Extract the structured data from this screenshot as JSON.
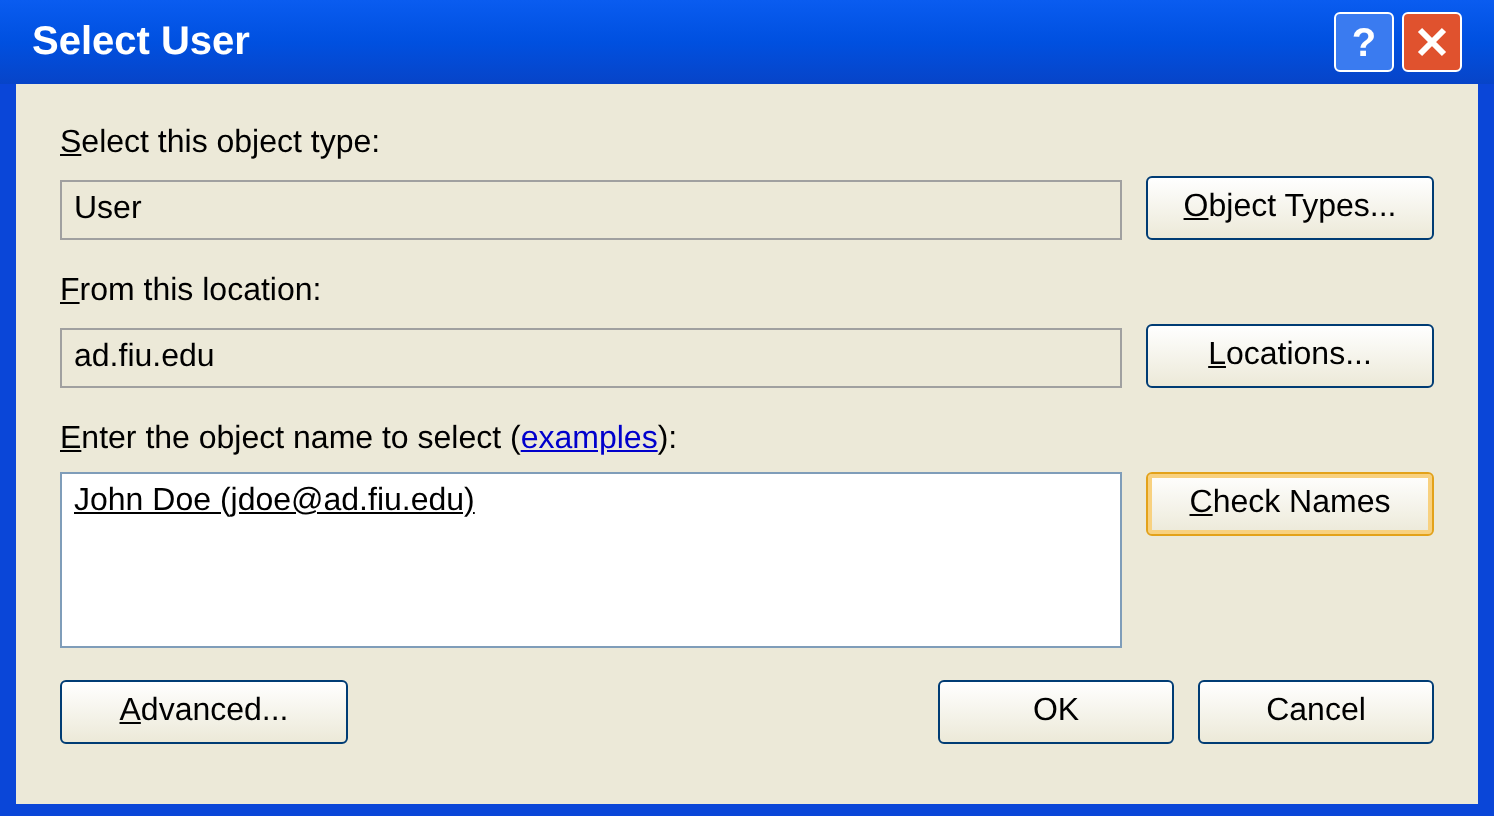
{
  "window": {
    "title": "Select User",
    "help_button": "?"
  },
  "object_type": {
    "label": [
      {
        "text": "S",
        "underlined": true
      },
      {
        "text": "elect this object type:",
        "underlined": false
      }
    ],
    "value": "User",
    "readonly": true,
    "button": {
      "label": [
        {
          "text": "O",
          "underlined": true
        },
        {
          "text": "bject Types...",
          "underlined": false
        }
      ],
      "focused": false
    }
  },
  "location": {
    "label": [
      {
        "text": "F",
        "underlined": true
      },
      {
        "text": "rom this location:",
        "underlined": false
      }
    ],
    "value": "ad.fiu.edu",
    "readonly": true,
    "button": {
      "label": [
        {
          "text": "L",
          "underlined": true
        },
        {
          "text": "ocations...",
          "underlined": false
        }
      ],
      "focused": false
    }
  },
  "names": {
    "label": [
      {
        "text": "E",
        "underlined": true
      },
      {
        "text": "nter the object name to select (",
        "underlined": false
      }
    ],
    "link": "examples",
    "label_after": "):",
    "value": "John Doe (jdoe@ad.fiu.edu)",
    "resolved": true,
    "readonly": false,
    "button": {
      "label": [
        {
          "text": "C",
          "underlined": true
        },
        {
          "text": "heck Names",
          "underlined": false
        }
      ],
      "focused": true
    }
  },
  "buttons": [
    {
      "label": [
        {
          "text": "A",
          "underlined": true
        },
        {
          "text": "dvanced...",
          "underlined": false
        }
      ]
    },
    {
      "label": [
        {
          "text": "OK",
          "underlined": false
        }
      ]
    },
    {
      "label": [
        {
          "text": "Cancel",
          "underlined": false
        }
      ]
    }
  ]
}
